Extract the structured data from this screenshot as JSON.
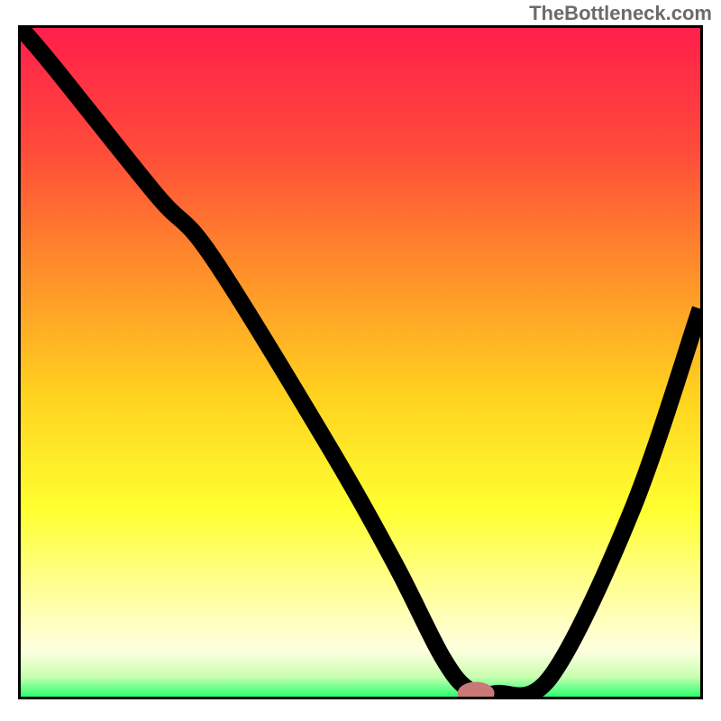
{
  "watermark": "TheBottleneck.com",
  "chart_data": {
    "type": "line",
    "title": "",
    "xlabel": "",
    "ylabel": "",
    "xlim": [
      0,
      100
    ],
    "ylim": [
      0,
      100
    ],
    "grid": false,
    "legend": false,
    "gradient_stops": [
      {
        "offset": 0,
        "color": "#ff1f4b"
      },
      {
        "offset": 18,
        "color": "#ff4a3a"
      },
      {
        "offset": 35,
        "color": "#ff8a2b"
      },
      {
        "offset": 55,
        "color": "#ffd21f"
      },
      {
        "offset": 72,
        "color": "#ffff30"
      },
      {
        "offset": 85,
        "color": "#ffffa0"
      },
      {
        "offset": 93,
        "color": "#ffffe0"
      },
      {
        "offset": 97,
        "color": "#c8ffb0"
      },
      {
        "offset": 100,
        "color": "#2bff70"
      }
    ],
    "series": [
      {
        "name": "bottleneck-curve",
        "x": [
          0,
          5,
          20,
          28,
          45,
          55,
          62,
          66,
          70,
          78,
          90,
          100
        ],
        "y": [
          100,
          94,
          75,
          66,
          38,
          20,
          6,
          1,
          0.5,
          3,
          28,
          58
        ]
      }
    ],
    "marker": {
      "x": 67,
      "y": 0.5,
      "rx": 2.2,
      "ry": 1.2,
      "color": "#c97878"
    }
  }
}
